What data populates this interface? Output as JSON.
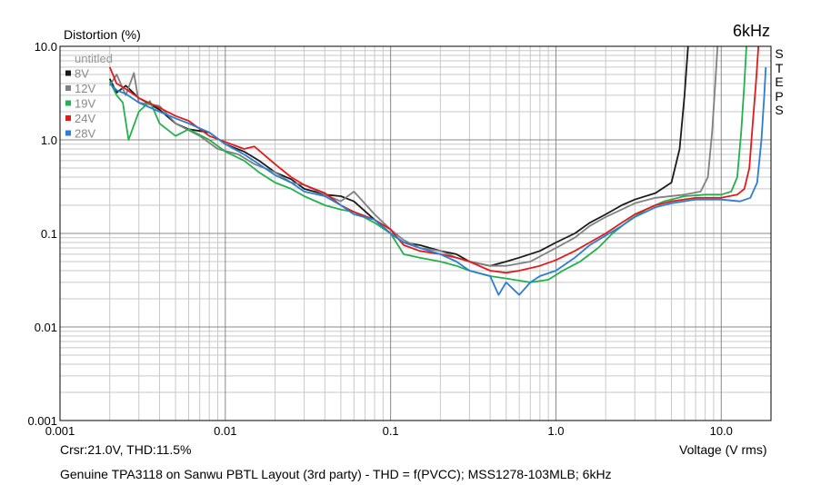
{
  "chart_data": {
    "type": "line",
    "title": "Distortion (%)",
    "corner_label": "6kHz",
    "side_label": "STEPS",
    "xlabel": "Voltage (V rms)",
    "cursor_readout": "Crsr:21.0V, THD:11.5%",
    "caption": "Genuine TPA3118 on Sanwu PBTL Layout (3rd party) - THD = f(PVCC); MSS1278-103MLB; 6kHz",
    "x_scale": "log",
    "y_scale": "log",
    "xlim": [
      0.001,
      20
    ],
    "ylim": [
      0.001,
      10
    ],
    "x_ticks": [
      0.001,
      0.01,
      0.1,
      1,
      10
    ],
    "x_tick_labels": [
      "0.001",
      "0.01",
      "0.1",
      "1.0",
      "10.0"
    ],
    "y_ticks": [
      0.001,
      0.01,
      0.1,
      1,
      10
    ],
    "y_tick_labels": [
      "0.001",
      "0.01",
      "0.1",
      "1.0",
      "10.0"
    ],
    "grid": true,
    "legend_position": "top-left",
    "legend_entries": [
      {
        "name": "untitled",
        "color": "#a0a0a0",
        "marker": false
      },
      {
        "name": "8V",
        "color": "#1a1a1a",
        "marker": true
      },
      {
        "name": "12V",
        "color": "#808080",
        "marker": true
      },
      {
        "name": "19V",
        "color": "#22b14c",
        "marker": true
      },
      {
        "name": "24V",
        "color": "#e31a1c",
        "marker": true
      },
      {
        "name": "28V",
        "color": "#2a7fd4",
        "marker": true
      }
    ],
    "series": [
      {
        "name": "8V",
        "color": "#1a1a1a",
        "points": [
          [
            0.002,
            4.5
          ],
          [
            0.0022,
            3.2
          ],
          [
            0.0025,
            3.8
          ],
          [
            0.003,
            2.8
          ],
          [
            0.004,
            2.1
          ],
          [
            0.005,
            1.5
          ],
          [
            0.006,
            1.3
          ],
          [
            0.008,
            1.2
          ],
          [
            0.01,
            0.9
          ],
          [
            0.013,
            0.75
          ],
          [
            0.016,
            0.6
          ],
          [
            0.02,
            0.45
          ],
          [
            0.025,
            0.38
          ],
          [
            0.03,
            0.3
          ],
          [
            0.04,
            0.26
          ],
          [
            0.05,
            0.25
          ],
          [
            0.06,
            0.22
          ],
          [
            0.08,
            0.14
          ],
          [
            0.1,
            0.1
          ],
          [
            0.12,
            0.08
          ],
          [
            0.15,
            0.075
          ],
          [
            0.2,
            0.065
          ],
          [
            0.25,
            0.06
          ],
          [
            0.3,
            0.05
          ],
          [
            0.4,
            0.045
          ],
          [
            0.5,
            0.05
          ],
          [
            0.6,
            0.055
          ],
          [
            0.8,
            0.065
          ],
          [
            1.0,
            0.08
          ],
          [
            1.3,
            0.1
          ],
          [
            1.6,
            0.13
          ],
          [
            2.0,
            0.16
          ],
          [
            2.5,
            0.2
          ],
          [
            3.0,
            0.23
          ],
          [
            4.0,
            0.27
          ],
          [
            5.0,
            0.35
          ],
          [
            5.6,
            0.8
          ],
          [
            6.0,
            3.0
          ],
          [
            6.3,
            10.0
          ]
        ]
      },
      {
        "name": "12V",
        "color": "#808080",
        "points": [
          [
            0.002,
            3.8
          ],
          [
            0.0022,
            5.0
          ],
          [
            0.0025,
            3.0
          ],
          [
            0.0028,
            5.2
          ],
          [
            0.003,
            2.5
          ],
          [
            0.004,
            2.3
          ],
          [
            0.005,
            1.5
          ],
          [
            0.007,
            1.1
          ],
          [
            0.009,
            0.8
          ],
          [
            0.012,
            0.7
          ],
          [
            0.015,
            0.55
          ],
          [
            0.02,
            0.45
          ],
          [
            0.025,
            0.35
          ],
          [
            0.03,
            0.33
          ],
          [
            0.04,
            0.26
          ],
          [
            0.05,
            0.22
          ],
          [
            0.06,
            0.28
          ],
          [
            0.08,
            0.16
          ],
          [
            0.1,
            0.11
          ],
          [
            0.12,
            0.085
          ],
          [
            0.15,
            0.07
          ],
          [
            0.2,
            0.065
          ],
          [
            0.25,
            0.055
          ],
          [
            0.3,
            0.05
          ],
          [
            0.4,
            0.045
          ],
          [
            0.5,
            0.045
          ],
          [
            0.7,
            0.05
          ],
          [
            1.0,
            0.07
          ],
          [
            1.3,
            0.09
          ],
          [
            1.6,
            0.12
          ],
          [
            2.0,
            0.15
          ],
          [
            2.5,
            0.18
          ],
          [
            3.0,
            0.21
          ],
          [
            4.0,
            0.24
          ],
          [
            6.0,
            0.26
          ],
          [
            7.5,
            0.28
          ],
          [
            8.3,
            0.4
          ],
          [
            8.8,
            1.2
          ],
          [
            9.2,
            4.0
          ],
          [
            9.5,
            10.0
          ]
        ]
      },
      {
        "name": "19V",
        "color": "#22b14c",
        "points": [
          [
            0.002,
            4.2
          ],
          [
            0.0022,
            3.0
          ],
          [
            0.0024,
            2.5
          ],
          [
            0.0026,
            1.0
          ],
          [
            0.003,
            2.0
          ],
          [
            0.0035,
            2.6
          ],
          [
            0.004,
            1.5
          ],
          [
            0.005,
            1.1
          ],
          [
            0.006,
            1.3
          ],
          [
            0.008,
            1.0
          ],
          [
            0.01,
            0.75
          ],
          [
            0.013,
            0.6
          ],
          [
            0.016,
            0.45
          ],
          [
            0.02,
            0.35
          ],
          [
            0.025,
            0.3
          ],
          [
            0.03,
            0.25
          ],
          [
            0.04,
            0.2
          ],
          [
            0.05,
            0.18
          ],
          [
            0.06,
            0.17
          ],
          [
            0.08,
            0.13
          ],
          [
            0.1,
            0.1
          ],
          [
            0.12,
            0.06
          ],
          [
            0.15,
            0.055
          ],
          [
            0.2,
            0.05
          ],
          [
            0.25,
            0.045
          ],
          [
            0.3,
            0.04
          ],
          [
            0.4,
            0.035
          ],
          [
            0.5,
            0.033
          ],
          [
            0.7,
            0.03
          ],
          [
            0.9,
            0.032
          ],
          [
            1.1,
            0.04
          ],
          [
            1.4,
            0.05
          ],
          [
            1.8,
            0.07
          ],
          [
            2.2,
            0.1
          ],
          [
            2.8,
            0.14
          ],
          [
            3.5,
            0.18
          ],
          [
            4.5,
            0.22
          ],
          [
            6.0,
            0.25
          ],
          [
            8.0,
            0.26
          ],
          [
            10.0,
            0.26
          ],
          [
            11.5,
            0.28
          ],
          [
            12.5,
            0.4
          ],
          [
            13.2,
            1.2
          ],
          [
            13.8,
            4.0
          ],
          [
            14.2,
            10.0
          ]
        ]
      },
      {
        "name": "24V",
        "color": "#e31a1c",
        "points": [
          [
            0.002,
            6.0
          ],
          [
            0.0022,
            4.0
          ],
          [
            0.0025,
            3.5
          ],
          [
            0.003,
            2.8
          ],
          [
            0.004,
            2.2
          ],
          [
            0.005,
            1.8
          ],
          [
            0.006,
            1.6
          ],
          [
            0.008,
            1.1
          ],
          [
            0.01,
            0.95
          ],
          [
            0.013,
            0.8
          ],
          [
            0.015,
            0.85
          ],
          [
            0.02,
            0.55
          ],
          [
            0.025,
            0.4
          ],
          [
            0.03,
            0.33
          ],
          [
            0.04,
            0.27
          ],
          [
            0.05,
            0.2
          ],
          [
            0.06,
            0.17
          ],
          [
            0.08,
            0.14
          ],
          [
            0.1,
            0.11
          ],
          [
            0.12,
            0.075
          ],
          [
            0.15,
            0.065
          ],
          [
            0.2,
            0.06
          ],
          [
            0.25,
            0.055
          ],
          [
            0.3,
            0.05
          ],
          [
            0.4,
            0.04
          ],
          [
            0.5,
            0.038
          ],
          [
            0.6,
            0.04
          ],
          [
            0.8,
            0.045
          ],
          [
            1.0,
            0.052
          ],
          [
            1.3,
            0.065
          ],
          [
            1.6,
            0.08
          ],
          [
            2.0,
            0.1
          ],
          [
            2.5,
            0.13
          ],
          [
            3.0,
            0.16
          ],
          [
            4.0,
            0.2
          ],
          [
            5.0,
            0.22
          ],
          [
            7.0,
            0.24
          ],
          [
            10.0,
            0.24
          ],
          [
            12.5,
            0.26
          ],
          [
            13.8,
            0.3
          ],
          [
            14.8,
            0.5
          ],
          [
            15.5,
            1.5
          ],
          [
            16.2,
            4.0
          ],
          [
            16.8,
            10.0
          ]
        ]
      },
      {
        "name": "28V",
        "color": "#2a7fd4",
        "points": [
          [
            0.002,
            4.0
          ],
          [
            0.0022,
            3.4
          ],
          [
            0.0025,
            3.1
          ],
          [
            0.003,
            2.5
          ],
          [
            0.004,
            2.0
          ],
          [
            0.005,
            1.7
          ],
          [
            0.006,
            1.5
          ],
          [
            0.008,
            1.2
          ],
          [
            0.01,
            0.9
          ],
          [
            0.013,
            0.7
          ],
          [
            0.016,
            0.55
          ],
          [
            0.02,
            0.42
          ],
          [
            0.025,
            0.35
          ],
          [
            0.03,
            0.28
          ],
          [
            0.04,
            0.25
          ],
          [
            0.05,
            0.2
          ],
          [
            0.06,
            0.16
          ],
          [
            0.08,
            0.14
          ],
          [
            0.1,
            0.1
          ],
          [
            0.12,
            0.08
          ],
          [
            0.15,
            0.07
          ],
          [
            0.2,
            0.06
          ],
          [
            0.25,
            0.05
          ],
          [
            0.3,
            0.04
          ],
          [
            0.4,
            0.035
          ],
          [
            0.45,
            0.022
          ],
          [
            0.5,
            0.03
          ],
          [
            0.6,
            0.022
          ],
          [
            0.7,
            0.03
          ],
          [
            0.8,
            0.035
          ],
          [
            1.0,
            0.04
          ],
          [
            1.3,
            0.055
          ],
          [
            1.6,
            0.075
          ],
          [
            2.0,
            0.095
          ],
          [
            2.5,
            0.12
          ],
          [
            3.0,
            0.15
          ],
          [
            4.0,
            0.19
          ],
          [
            5.0,
            0.21
          ],
          [
            7.0,
            0.23
          ],
          [
            10.0,
            0.23
          ],
          [
            13.0,
            0.22
          ],
          [
            15.0,
            0.24
          ],
          [
            16.5,
            0.35
          ],
          [
            17.5,
            1.0
          ],
          [
            18.2,
            3.0
          ],
          [
            18.6,
            6.0
          ]
        ]
      }
    ]
  }
}
